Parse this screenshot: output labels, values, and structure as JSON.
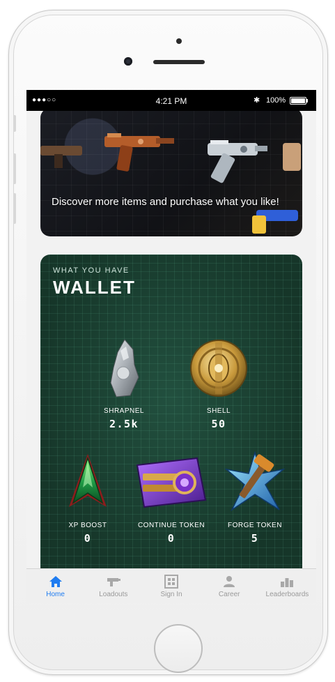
{
  "status_bar": {
    "carrier": "●●●○○",
    "time": "4:21 PM",
    "bluetooth": "✱",
    "battery": "100%"
  },
  "banner": {
    "text": "Discover more items and purchase what you like!"
  },
  "wallet": {
    "eyebrow": "WHAT YOU HAVE",
    "title": "WALLET",
    "items": [
      {
        "label": "SHRAPNEL",
        "value": "2.5k",
        "icon": "shrapnel-icon"
      },
      {
        "label": "SHELL",
        "value": "50",
        "icon": "shell-icon"
      },
      {
        "label": "XP BOOST",
        "value": "0",
        "icon": "xp-boost-icon"
      },
      {
        "label": "CONTINUE TOKEN",
        "value": "0",
        "icon": "continue-token-icon"
      },
      {
        "label": "FORGE TOKEN",
        "value": "5",
        "icon": "forge-token-icon"
      }
    ]
  },
  "tabs": [
    {
      "label": "Home",
      "icon": "home-icon",
      "active": true
    },
    {
      "label": "Loadouts",
      "icon": "loadouts-icon",
      "active": false
    },
    {
      "label": "Sign In",
      "icon": "sign-in-icon",
      "active": false
    },
    {
      "label": "Career",
      "icon": "career-icon",
      "active": false
    },
    {
      "label": "Leaderboards",
      "icon": "leaderboards-icon",
      "active": false
    }
  ],
  "colors": {
    "accent": "#1f7cf0",
    "wallet_bg": "#183d32",
    "tab_inactive": "#9a9a9a"
  }
}
